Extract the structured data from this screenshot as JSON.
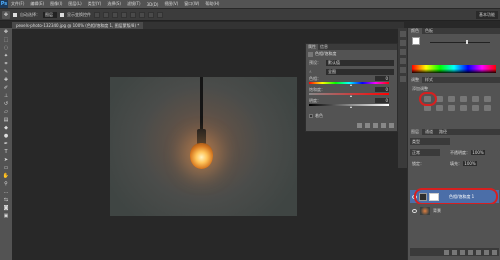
{
  "app": {
    "logo": "Ps"
  },
  "menu": [
    "文件(F)",
    "编辑(E)",
    "图像(I)",
    "图层(L)",
    "类型(Y)",
    "选择(S)",
    "滤镜(T)",
    "3D(D)",
    "视图(V)",
    "窗口(W)",
    "帮助(H)"
  ],
  "options": {
    "auto_select_label": "自动选择：",
    "auto_select_value": "图层",
    "show_transform_label": "显示变换控件",
    "workspace": "基本功能"
  },
  "document": {
    "tab_label": "pexels-photo-132340.jpg @ 100% (色相/饱和度 1, 图层蒙版/8) *"
  },
  "properties": {
    "tabs": [
      "属性",
      "信息"
    ],
    "title": "色相/饱和度",
    "preset_label": "预设：",
    "preset_value": "默认值",
    "channel_value": "全图",
    "hue_label": "色相：",
    "hue_value": "0",
    "saturation_label": "饱和度：",
    "saturation_value": "0",
    "lightness_label": "明度：",
    "lightness_value": "0",
    "colorize_label": "着色"
  },
  "dock": {
    "color_tabs": [
      "颜色",
      "色板"
    ],
    "adjust_tabs": [
      "调整",
      "样式"
    ],
    "adjust_label": "添加调整",
    "layers_tabs": [
      "图层",
      "通道",
      "路径"
    ],
    "kind_label": "类型",
    "blend_mode": "正常",
    "opacity_label": "不透明度：",
    "opacity_value": "100%",
    "lock_label": "锁定：",
    "fill_label": "填充：",
    "fill_value": "100%",
    "layers": [
      {
        "name": "色相/饱和度 1"
      },
      {
        "name": "背景"
      }
    ]
  },
  "colors": {
    "accent_highlight": "#d62020",
    "selected_layer": "#4b6ea8"
  }
}
